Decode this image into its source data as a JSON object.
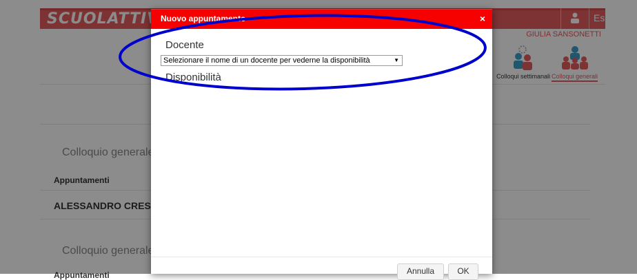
{
  "header": {
    "logo": "SCUOLATTIVA",
    "logout_label": "Esci",
    "username": "GIULIA SANSONETTI"
  },
  "nav": {
    "items": [
      {
        "label": "Colloqui settimanali"
      },
      {
        "label": "Colloqui generali"
      }
    ]
  },
  "background": {
    "section1_title": "Colloquio generale del",
    "appointments_label": "Appuntamenti",
    "teacher_name": "ALESSANDRO CRESCENZ",
    "section2_title": "Colloquio generale del",
    "appointments_label_2": "Appuntamenti"
  },
  "modal": {
    "title": "Nuovo appuntamento",
    "close": "×",
    "teacher_label": "Docente",
    "teacher_select_value": "Selezionare il nome di un docente per vederne la disponibilità",
    "availability_label": "Disponibilità",
    "cancel_label": "Annulla",
    "ok_label": "OK"
  },
  "colors": {
    "brand": "#e45b5d",
    "modal_header": "#f60000",
    "annotation": "#0000cc"
  }
}
